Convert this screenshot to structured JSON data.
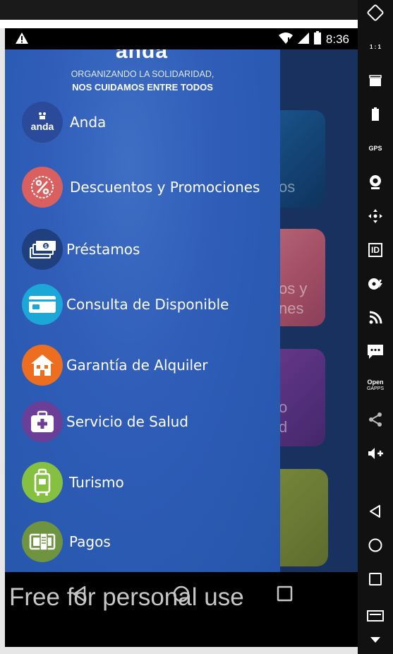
{
  "status_bar": {
    "time": "8:36"
  },
  "drawer": {
    "logo": "anda",
    "tagline_line1": "ORGANIZANDO LA SOLIDARIDAD,",
    "tagline_line2": "NOS CUIDAMOS ENTRE TODOS",
    "items": [
      {
        "label": "Anda",
        "icon_text": "anda",
        "icon": "anda-logo-icon",
        "color": "#2b4a9a"
      },
      {
        "label": "Descuentos y Promociones",
        "icon": "percent-badge-icon",
        "color": "#d9605f"
      },
      {
        "label": "Préstamos",
        "icon": "money-stack-icon",
        "color": "#1f3f7e"
      },
      {
        "label": "Consulta de Disponible",
        "icon": "card-icon",
        "color": "#1ba7d8"
      },
      {
        "label": "Garantía de Alquiler",
        "icon": "house-icon",
        "color": "#ee6e1f"
      },
      {
        "label": "Servicio de Salud",
        "icon": "medical-kit-icon",
        "color": "#6b3e97"
      },
      {
        "label": "Turismo",
        "icon": "suitcase-icon",
        "color": "#85c041"
      },
      {
        "label": "Pagos",
        "icon": "bill-payment-icon",
        "color": "#6f9440"
      }
    ]
  },
  "background_cards": {
    "card1": "os",
    "card2_line1": "os y",
    "card2_line2": "nes",
    "card3_line1": "o",
    "card3_line2": "d"
  },
  "side_toolbar": {
    "scale": "1 : 1",
    "gps": "GPS",
    "id": "ID",
    "open_gapps_1": "Open",
    "open_gapps_2": "GAPPS"
  },
  "watermark": "Free for personal use",
  "colors": {
    "drawer_blue": "#2d5bb5",
    "app_navy": "#18315e",
    "toolbar": "#111111"
  }
}
